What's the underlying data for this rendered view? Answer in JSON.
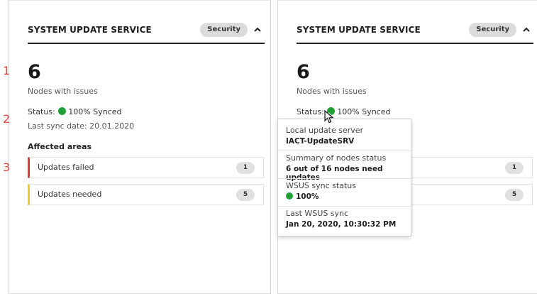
{
  "left_panel": {
    "title": "SYSTEM UPDATE SERVICE",
    "tag": "Security",
    "count": "6",
    "count_label": "Nodes with issues",
    "status_label": "Status:",
    "status_value": "100% Synced",
    "last_sync": "Last sync date: 20.01.2020",
    "affected_title": "Affected areas",
    "areas": [
      {
        "label": "Updates failed",
        "count": "1",
        "color": "#e03c31"
      },
      {
        "label": "Updates needed",
        "count": "5",
        "color": "#f2cc1f"
      }
    ]
  },
  "right_panel": {
    "title": "SYSTEM UPDATE SERVICE",
    "tag": "Security",
    "count": "6",
    "count_label": "Nodes with issues",
    "status_label": "Status:",
    "status_value": "100% Synced",
    "area_counts": [
      "1",
      "5"
    ]
  },
  "markers": [
    "1",
    "2",
    "3"
  ],
  "tooltip": {
    "local_server_label": "Local update server",
    "local_server_value": "IACT-UpdateSRV",
    "summary_label": "Summary of nodes status",
    "summary_value": "6 out of 16 nodes need updates",
    "wsus_status_label": "WSUS sync status",
    "wsus_status_value": "100%",
    "last_wsus_label": "Last WSUS sync",
    "last_wsus_value": "Jan 20, 2020, 10:30:32 PM"
  },
  "colors": {
    "synced": "#21a038",
    "failed": "#e03c31",
    "needed": "#f2cc1f",
    "marker": "#e8443a"
  }
}
